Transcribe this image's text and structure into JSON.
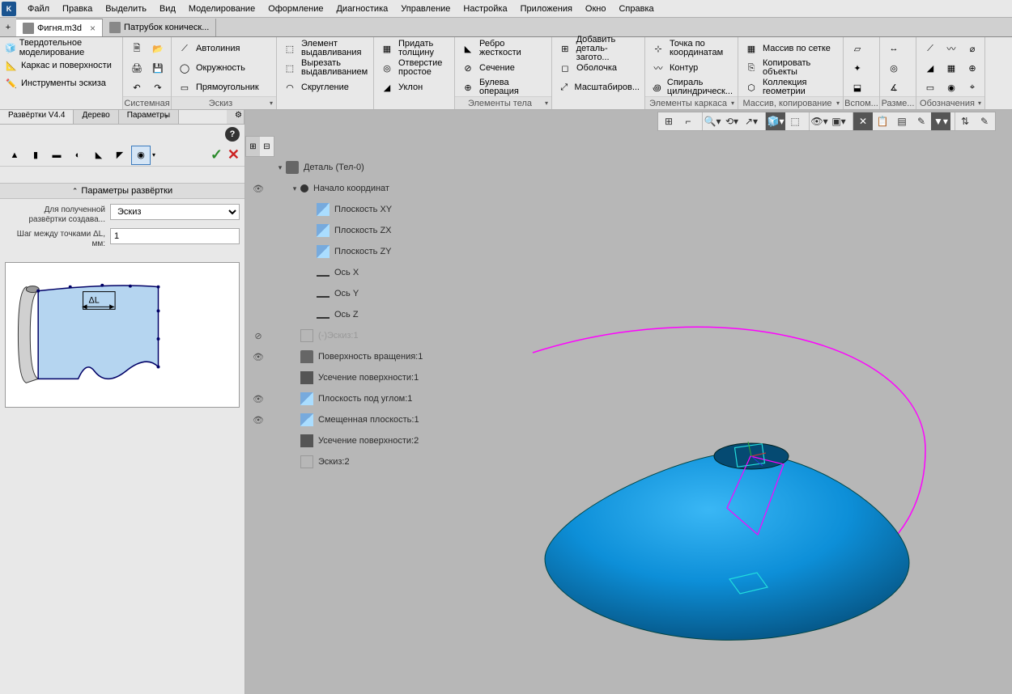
{
  "menu": [
    "Файл",
    "Правка",
    "Выделить",
    "Вид",
    "Моделирование",
    "Оформление",
    "Диагностика",
    "Управление",
    "Настройка",
    "Приложения",
    "Окно",
    "Справка"
  ],
  "tabs": [
    {
      "label": "Фигня.m3d",
      "active": true,
      "closable": true
    },
    {
      "label": "Патрубок коническ...",
      "active": false,
      "closable": false
    }
  ],
  "ribbon": {
    "group0": {
      "items": [
        "Твердотельное моделирование",
        "Каркас и поверхности",
        "Инструменты эскиза"
      ]
    },
    "group1": {
      "label": "Системная"
    },
    "group2": {
      "label": "Эскиз",
      "items": [
        "Автолиния",
        "Окружность",
        "Прямоугольник"
      ]
    },
    "group3": {
      "items": [
        [
          "Элемент",
          "выдавливания"
        ],
        [
          "Вырезать",
          "выдавливанием"
        ],
        [
          "Скругление",
          ""
        ]
      ]
    },
    "group4": {
      "items": [
        [
          "Придать",
          "толщину"
        ],
        [
          "Отверстие",
          "простое"
        ],
        [
          "Уклон",
          ""
        ]
      ]
    },
    "group5": {
      "label": "Элементы тела",
      "items": [
        [
          "Ребро",
          "жесткости"
        ],
        [
          "Сечение",
          ""
        ],
        [
          "Булева",
          "операция"
        ]
      ]
    },
    "group6": {
      "items": [
        [
          "Добавить",
          "деталь-загото..."
        ],
        [
          "Оболочка",
          ""
        ],
        [
          "Масштабиров...",
          ""
        ]
      ]
    },
    "group7": {
      "label": "Элементы каркаса",
      "items": [
        [
          "Точка по",
          "координатам"
        ],
        [
          "Контур",
          ""
        ],
        [
          "Спираль",
          "цилиндрическ..."
        ]
      ]
    },
    "group8": {
      "label": "Массив, копирование",
      "items": [
        [
          "Массив по сетке",
          ""
        ],
        [
          "Копировать",
          "объекты"
        ],
        [
          "Коллекция",
          "геометрии"
        ]
      ]
    },
    "group9": {
      "label": "Вспом..."
    },
    "group10": {
      "label": "Разме..."
    },
    "group11": {
      "label": "Обозначения"
    }
  },
  "side": {
    "tabs": [
      "Развёртки V4.4",
      "Дерево",
      "Параметры"
    ],
    "section_title": "Параметры развёртки",
    "param1": {
      "label": "Для полученной развёртки создава...",
      "value": "Эскиз"
    },
    "param2": {
      "label": "Шаг между точками ΔL, мм:",
      "value": "1"
    }
  },
  "tree": [
    {
      "lvl": 0,
      "tw": "▾",
      "eye": "",
      "ic": "part",
      "txt": "Деталь (Тел-0)"
    },
    {
      "lvl": 1,
      "tw": "▾",
      "eye": "👁",
      "ic": "org",
      "txt": "Начало координат"
    },
    {
      "lvl": 2,
      "tw": "",
      "eye": "",
      "ic": "plane",
      "txt": "Плоскость XY"
    },
    {
      "lvl": 2,
      "tw": "",
      "eye": "",
      "ic": "plane",
      "txt": "Плоскость ZX"
    },
    {
      "lvl": 2,
      "tw": "",
      "eye": "",
      "ic": "plane",
      "txt": "Плоскость ZY"
    },
    {
      "lvl": 2,
      "tw": "",
      "eye": "",
      "ic": "axis",
      "txt": "Ось X"
    },
    {
      "lvl": 2,
      "tw": "",
      "eye": "",
      "ic": "axis",
      "txt": "Ось Y"
    },
    {
      "lvl": 2,
      "tw": "",
      "eye": "",
      "ic": "axis",
      "txt": "Ось Z"
    },
    {
      "lvl": 1,
      "tw": "",
      "eye": "⊘",
      "ic": "sk",
      "txt": "(-)Эскиз:1",
      "dim": true
    },
    {
      "lvl": 1,
      "tw": "",
      "eye": "👁",
      "ic": "surf",
      "txt": "Поверхность вращения:1"
    },
    {
      "lvl": 1,
      "tw": "",
      "eye": "",
      "ic": "cut",
      "txt": "Усечение поверхности:1"
    },
    {
      "lvl": 1,
      "tw": "",
      "eye": "👁",
      "ic": "plane",
      "txt": "Плоскость под углом:1"
    },
    {
      "lvl": 1,
      "tw": "",
      "eye": "👁",
      "ic": "plane",
      "txt": "Смещенная плоскость:1"
    },
    {
      "lvl": 1,
      "tw": "",
      "eye": "",
      "ic": "cut",
      "txt": "Усечение поверхности:2"
    },
    {
      "lvl": 1,
      "tw": "",
      "eye": "",
      "ic": "sk",
      "txt": "Эскиз:2"
    }
  ]
}
